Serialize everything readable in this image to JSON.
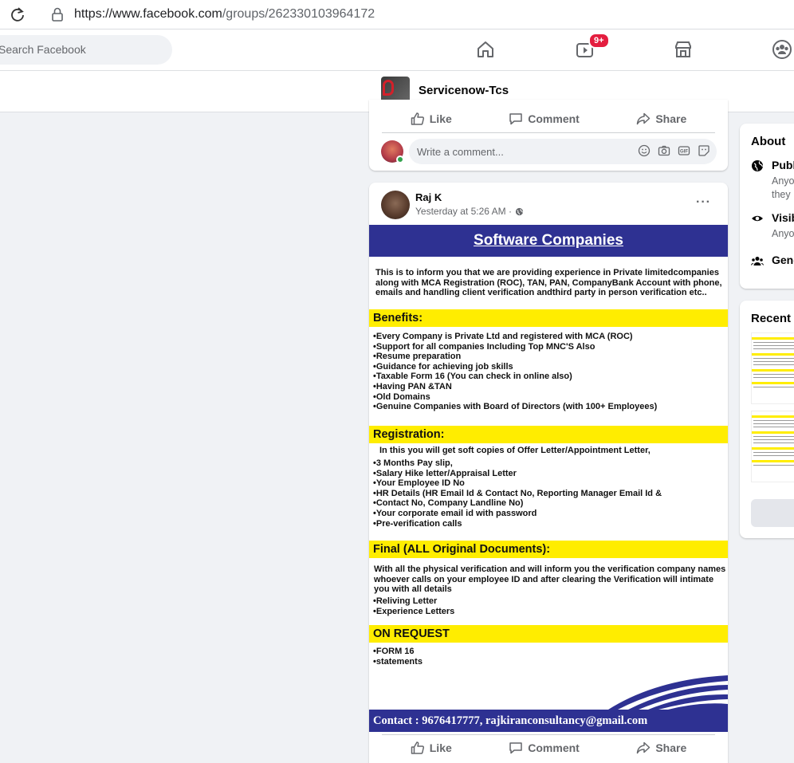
{
  "browser": {
    "url_domain": "https://www.facebook.com",
    "url_path": "/groups/262330103964172"
  },
  "nav": {
    "search_placeholder": "Search Facebook",
    "watch_badge": "9+",
    "icons": [
      "home-icon",
      "watch-icon",
      "marketplace-icon",
      "groups-icon"
    ]
  },
  "group": {
    "name": "Servicenow-Tcs"
  },
  "post_actions": {
    "like": "Like",
    "comment": "Comment",
    "share": "Share"
  },
  "comment_box": {
    "placeholder": "Write a comment..."
  },
  "post": {
    "author": "Raj K",
    "time": "Yesterday at 5:26 AM · ",
    "more": "···"
  },
  "flyer": {
    "title": "Software Companies",
    "intro": [
      "This is to inform you that we are providing experience in Private limitedcompanies",
      "along with MCA Registration (ROC), TAN, PAN, CompanyBank Account with phone,",
      "emails and handling client verification andthird party in person verification etc.."
    ],
    "benefits_heading": "Benefits:",
    "benefits": [
      "Every Company is Private Ltd and registered with MCA (ROC)",
      "Support for all companies Including Top MNC'S Also",
      "Resume preparation",
      "Guidance for achieving job skills",
      "Taxable Form 16 (You can check in online also)",
      "Having PAN &TAN",
      "Old Domains",
      "Genuine Companies with Board of Directors (with 100+ Employees)"
    ],
    "registration_heading": "Registration:",
    "registration_intro": "In this you will get soft copies of Offer Letter/Appointment Letter,",
    "registration": [
      "3 Months Pay slip,",
      "Salary Hike letter/Appraisal Letter",
      "Your Employee ID No",
      "HR Details (HR Email Id & Contact No, Reporting Manager Email Id &",
      "Contact No, Company Landline No)",
      "Your corporate email id with password",
      "Pre-verification calls"
    ],
    "final_heading": "Final (ALL Original Documents):",
    "final_intro": [
      "With all the physical verification and will inform you the verification company names",
      "whoever calls on your employee ID and after clearing the Verification will intimate",
      "you with all details"
    ],
    "final": [
      "Reliving Letter",
      "Experience Letters"
    ],
    "request_heading": "ON REQUEST",
    "request": [
      "FORM 16",
      "statements"
    ],
    "contact": "Contact : 9676417777,  rajkiranconsultancy@gmail.com"
  },
  "sidebar": {
    "about_title": "About",
    "items": [
      {
        "label": "Publ",
        "sub1": "Anyo",
        "sub2": "they"
      },
      {
        "label": "Visib",
        "sub1": "Anyo"
      },
      {
        "label": "Gene"
      }
    ],
    "recent_title": "Recent I"
  }
}
